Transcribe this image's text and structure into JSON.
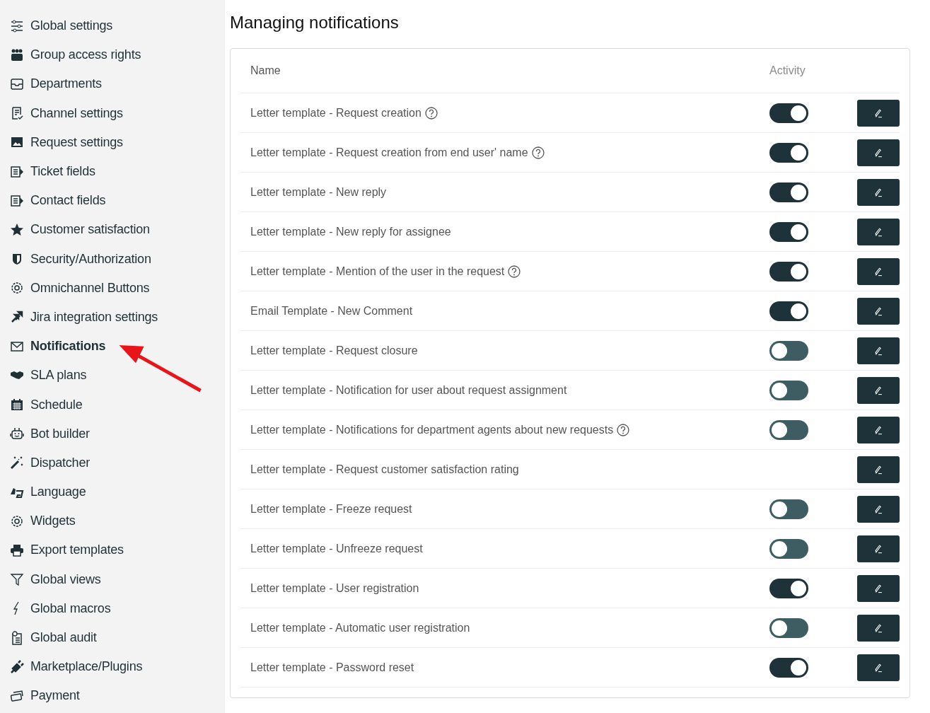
{
  "sidebar": {
    "items": [
      {
        "label": "Global settings",
        "selected": false
      },
      {
        "label": "Group access rights",
        "selected": false
      },
      {
        "label": "Departments",
        "selected": false
      },
      {
        "label": "Channel settings",
        "selected": false
      },
      {
        "label": "Request settings",
        "selected": false
      },
      {
        "label": "Ticket fields",
        "selected": false
      },
      {
        "label": "Contact fields",
        "selected": false
      },
      {
        "label": "Customer satisfaction",
        "selected": false
      },
      {
        "label": "Security/Authorization",
        "selected": false
      },
      {
        "label": "Omnichannel Buttons",
        "selected": false
      },
      {
        "label": "Jira integration settings",
        "selected": false
      },
      {
        "label": "Notifications",
        "selected": true
      },
      {
        "label": "SLA plans",
        "selected": false
      },
      {
        "label": "Schedule",
        "selected": false
      },
      {
        "label": "Bot builder",
        "selected": false
      },
      {
        "label": "Dispatcher",
        "selected": false
      },
      {
        "label": "Language",
        "selected": false
      },
      {
        "label": "Widgets",
        "selected": false
      },
      {
        "label": "Export templates",
        "selected": false
      },
      {
        "label": "Global views",
        "selected": false
      },
      {
        "label": "Global macros",
        "selected": false
      },
      {
        "label": "Global audit",
        "selected": false
      },
      {
        "label": "Marketplace/Plugins",
        "selected": false
      },
      {
        "label": "Payment",
        "selected": false
      }
    ]
  },
  "page": {
    "title": "Managing notifications"
  },
  "table": {
    "columns": [
      "Name",
      "Activity"
    ],
    "rows": [
      {
        "name": "Letter template - Request creation",
        "help": true,
        "kind": "toggle",
        "on": true
      },
      {
        "name": "Letter template - Request creation from end user' name",
        "help": true,
        "kind": "toggle",
        "on": true
      },
      {
        "name": "Letter template - New reply",
        "help": false,
        "kind": "toggle",
        "on": true
      },
      {
        "name": "Letter template - New reply for assignee",
        "help": false,
        "kind": "toggle",
        "on": true
      },
      {
        "name": "Letter template - Mention of the user in the request",
        "help": true,
        "kind": "toggle",
        "on": true
      },
      {
        "name": "Email Template - New Comment",
        "help": false,
        "kind": "toggle",
        "on": true
      },
      {
        "name": "Letter template - Request closure",
        "help": false,
        "kind": "toggle",
        "on": false
      },
      {
        "name": "Letter template - Notification for user about request assignment",
        "help": false,
        "kind": "toggle",
        "on": false
      },
      {
        "name": "Letter template - Notifications for department agents about new requests",
        "help": true,
        "kind": "toggle",
        "on": false
      },
      {
        "name": "Letter template - Request customer satisfaction rating",
        "help": false,
        "kind": "plain"
      },
      {
        "name": "Letter template - Freeze request",
        "help": false,
        "kind": "toggle",
        "on": false
      },
      {
        "name": "Letter template - Unfreeze request",
        "help": false,
        "kind": "toggle",
        "on": false
      },
      {
        "name": "Letter template - User registration",
        "help": false,
        "kind": "toggle",
        "on": true
      },
      {
        "name": "Letter template - Automatic user registration",
        "help": false,
        "kind": "toggle",
        "on": false
      },
      {
        "name": "Letter template - Password reset",
        "help": false,
        "kind": "toggle",
        "on": true
      }
    ]
  }
}
